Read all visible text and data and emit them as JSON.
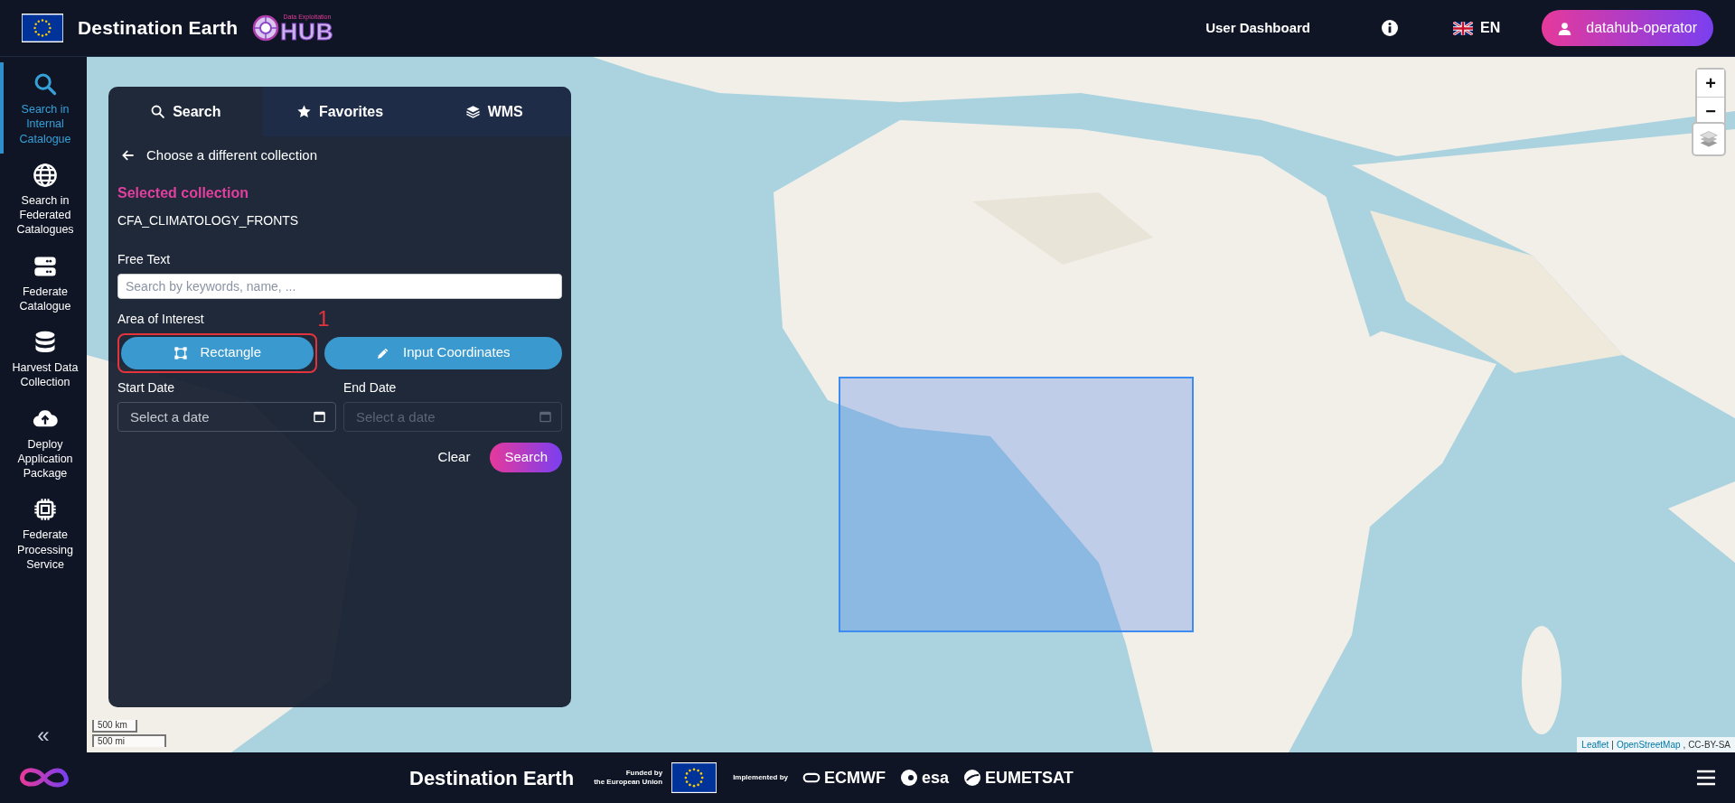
{
  "header": {
    "title": "Destination Earth",
    "hub_caption": "Data Exploitation",
    "hub_word": "HUB",
    "nav_link": "User Dashboard",
    "language": "EN",
    "user": "datahub-operator"
  },
  "sidebar": {
    "items": [
      {
        "label": "Search in Internal Catalogue",
        "selected": true
      },
      {
        "label": "Search in Federated Catalogues",
        "selected": false
      },
      {
        "label": "Federate Catalogue",
        "selected": false
      },
      {
        "label": "Harvest Data Collection",
        "selected": false
      },
      {
        "label": "Deploy Application Package",
        "selected": false
      },
      {
        "label": "Federate Processing Service",
        "selected": false
      }
    ],
    "collapse": "«"
  },
  "panel": {
    "tabs": [
      {
        "label": "Search",
        "selected": true
      },
      {
        "label": "Favorites",
        "selected": false
      },
      {
        "label": "WMS",
        "selected": false
      }
    ],
    "back_link": "Choose a different collection",
    "selected_heading": "Selected collection",
    "collection": "CFA_CLIMATOLOGY_FRONTS",
    "free_text": {
      "label": "Free Text",
      "placeholder": "Search by keywords, name, ..."
    },
    "area_label": "Area of Interest",
    "area_buttons": [
      {
        "label": "Rectangle",
        "highlighted": true
      },
      {
        "label": "Input Coordinates",
        "highlighted": false
      }
    ],
    "annotation": "1",
    "dates": [
      {
        "label": "Start Date",
        "placeholder": "Select a date",
        "disabled": false
      },
      {
        "label": "End Date",
        "placeholder": "Select a date",
        "disabled": true
      }
    ],
    "clear": "Clear",
    "search": "Search"
  },
  "map": {
    "zoom_in": "+",
    "zoom_out": "−",
    "scale": [
      "500 km",
      "500 mi"
    ],
    "attribution": [
      {
        "text": "Leaflet",
        "kind": "link"
      },
      {
        "text": "|",
        "kind": "text"
      },
      {
        "text": "OpenStreetMap",
        "kind": "link"
      },
      {
        "text": ", CC-BY-SA",
        "kind": "text"
      }
    ]
  },
  "footer": {
    "title": "Destination Earth",
    "funded_by": [
      "Funded by",
      "the European Union"
    ],
    "implemented_by": "Implemented by",
    "partners": [
      "ECMWF",
      "esa",
      "EUMETSAT"
    ]
  }
}
